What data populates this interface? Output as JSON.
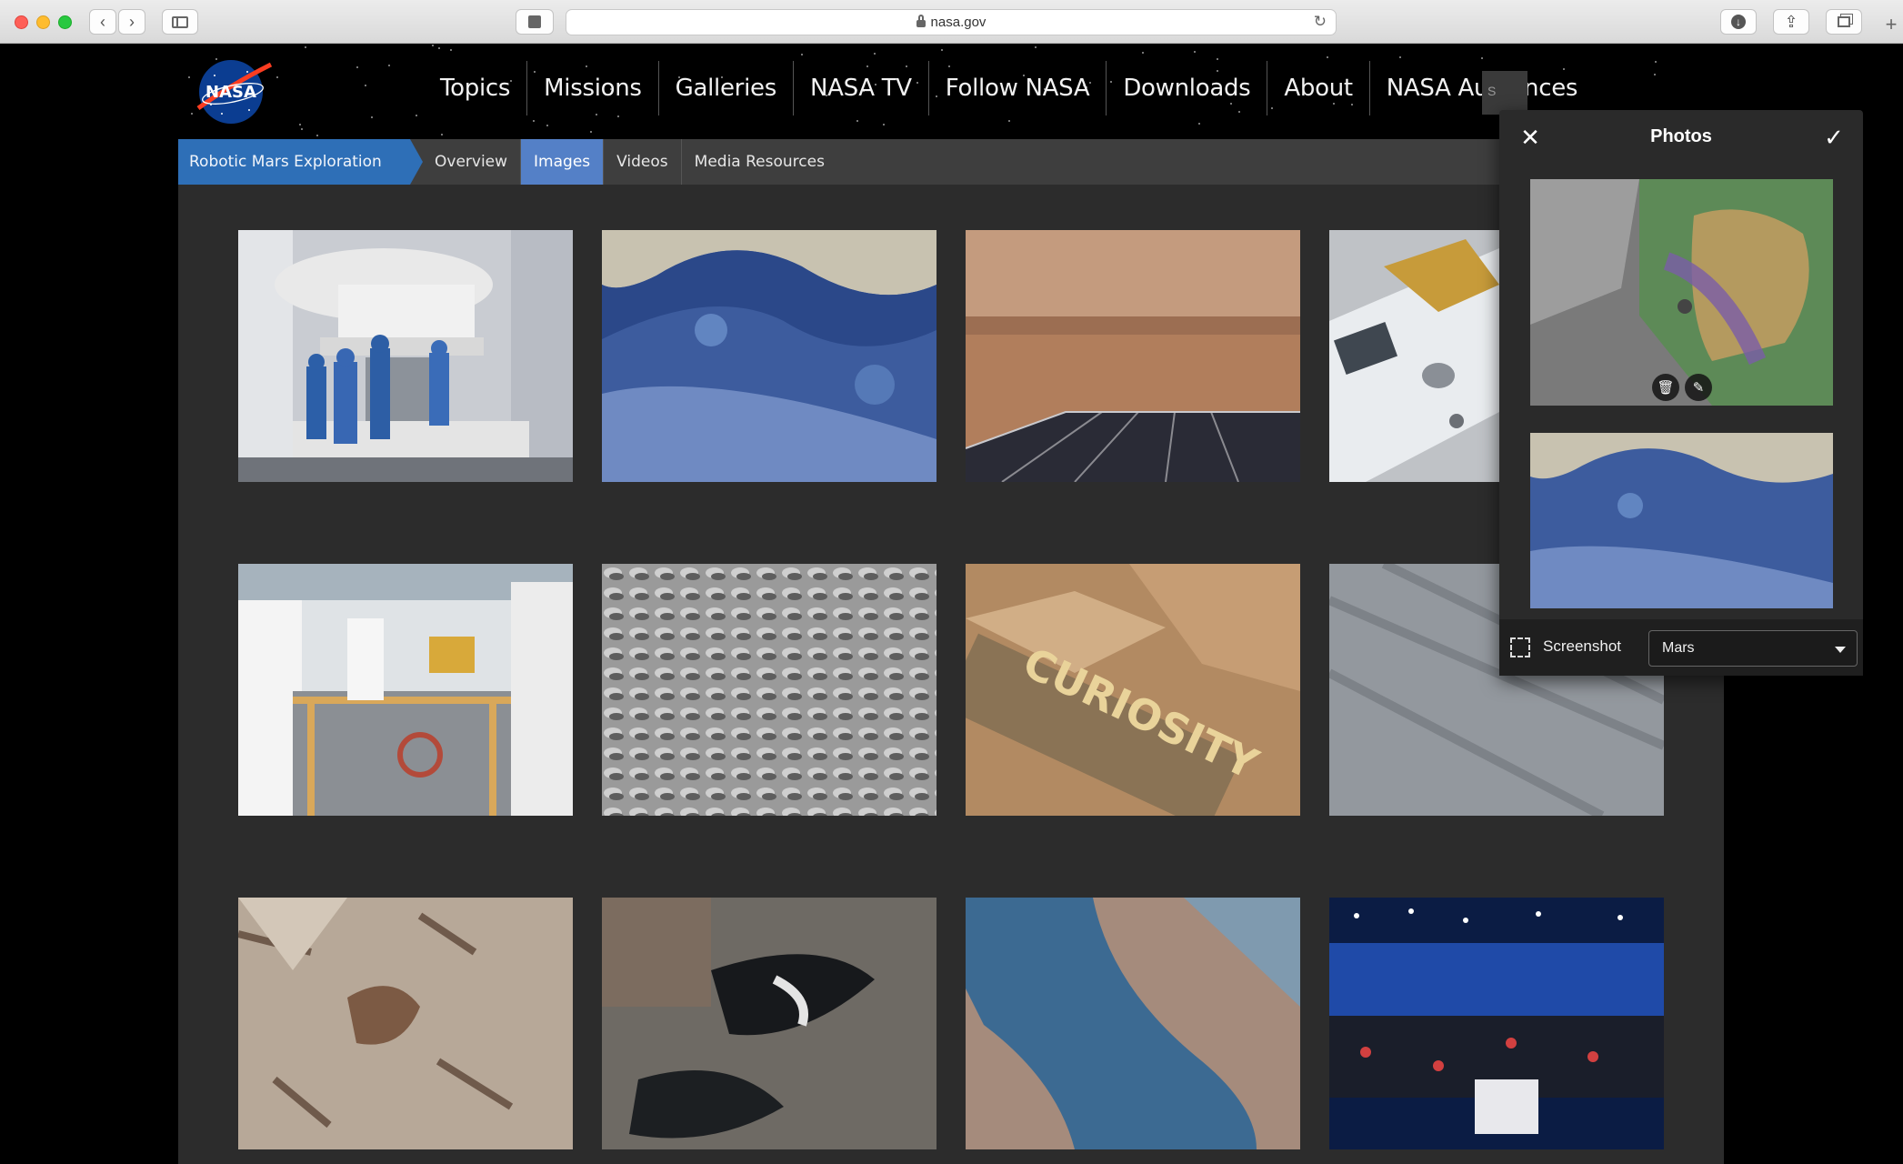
{
  "browser": {
    "url": "nasa.gov"
  },
  "site": {
    "logo_text": "NASA",
    "nav": [
      {
        "label": "Topics"
      },
      {
        "label": "Missions"
      },
      {
        "label": "Galleries"
      },
      {
        "label": "NASA TV"
      },
      {
        "label": "Follow NASA"
      },
      {
        "label": "Downloads"
      },
      {
        "label": "About"
      },
      {
        "label": "NASA Audiences"
      }
    ],
    "search_stub": "S"
  },
  "subnav": {
    "section": "Robotic Mars Exploration",
    "tabs": [
      {
        "label": "Overview",
        "active": false
      },
      {
        "label": "Images",
        "active": true
      },
      {
        "label": "Videos",
        "active": false
      },
      {
        "label": "Media Resources",
        "active": false
      }
    ]
  },
  "gallery": {
    "images": [
      {
        "subject": "spacecraft-cleanroom"
      },
      {
        "subject": "mars-blue-terrain"
      },
      {
        "subject": "insight-solar-panel"
      },
      {
        "subject": "spacecraft-hardware"
      },
      {
        "subject": "rover-assembly"
      },
      {
        "subject": "mars-dunes-gray"
      },
      {
        "subject": "curiosity-rock"
      },
      {
        "subject": "mars-gray-streaks"
      },
      {
        "subject": "mars-tan-gullies"
      },
      {
        "subject": "mars-dark-dunes"
      },
      {
        "subject": "mars-blue-channel"
      },
      {
        "subject": "nasdaq-celebration"
      }
    ]
  },
  "photos_popover": {
    "title": "Photos",
    "screenshot_label": "Screenshot",
    "album": "Mars"
  },
  "colors": {
    "page_bg": "#000000",
    "content_bg": "#2c2c2c",
    "subnav_bg": "#3e3e3e",
    "crumb_blue": "#2e6fb7",
    "active_tab": "#5480c7",
    "popover_bg": "#2a2a2a"
  }
}
